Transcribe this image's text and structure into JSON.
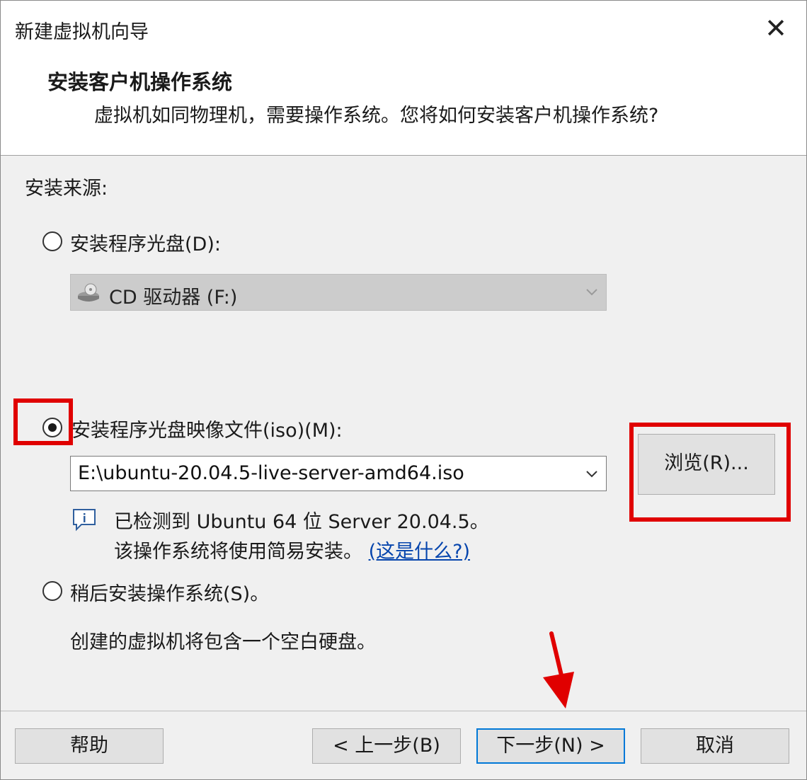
{
  "window": {
    "title": "新建虚拟机向导",
    "close_icon": "close-icon"
  },
  "header": {
    "heading": "安装客户机操作系统",
    "description": "虚拟机如同物理机，需要操作系统。您将如何安装客户机操作系统?"
  },
  "install_source": {
    "label": "安装来源:",
    "options": [
      {
        "label": "安装程序光盘(D):",
        "selected": false
      },
      {
        "label": "安装程序光盘映像文件(iso)(M):",
        "selected": true
      },
      {
        "label": "稍后安装操作系统(S)。",
        "selected": false
      }
    ],
    "cd_drive": {
      "value": "CD 驱动器 (F:)",
      "icon": "cd-drive-icon",
      "disabled": true
    },
    "iso_path": {
      "value": "E:\\ubuntu-20.04.5-live-server-amd64.iso"
    },
    "browse_label": "浏览(R)...",
    "detected_line": "已检测到 Ubuntu 64 位 Server 20.04.5。",
    "easy_install_line": "该操作系统将使用简易安装。",
    "whats_this_link": "(这是什么?)",
    "empty_disk_note": "创建的虚拟机将包含一个空白硬盘。"
  },
  "footer": {
    "help_label": "帮助",
    "back_label": "< 上一步(B)",
    "next_label": "下一步(N) >",
    "cancel_label": "取消"
  },
  "colors": {
    "highlight": "#e00000",
    "default_button_border": "#0078d7",
    "link": "#0645ad"
  }
}
